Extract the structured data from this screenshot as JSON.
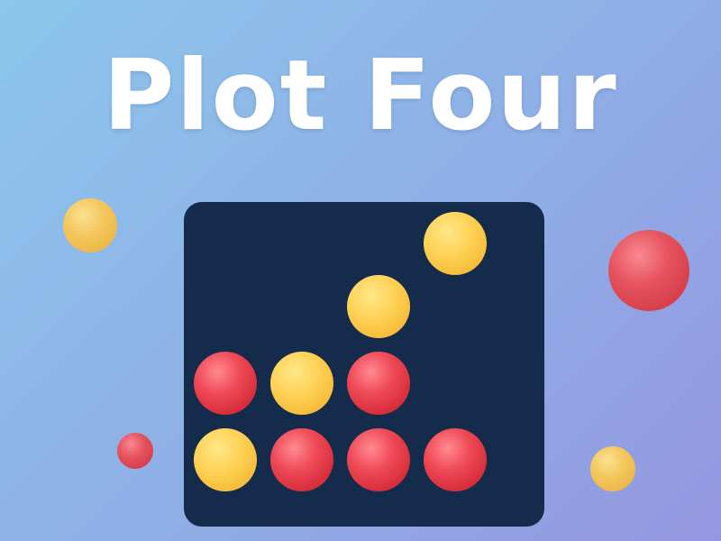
{
  "title": "Plot Four",
  "colors": {
    "red": "#e63c48",
    "yellow": "#fcc846",
    "board": "#152b4b"
  },
  "board": {
    "columns": 4,
    "rows": 4,
    "discs": [
      {
        "col": 1,
        "row": 1,
        "color": "yellow"
      },
      {
        "col": 2,
        "row": 1,
        "color": "red"
      },
      {
        "col": 3,
        "row": 1,
        "color": "red"
      },
      {
        "col": 4,
        "row": 1,
        "color": "red"
      },
      {
        "col": 1,
        "row": 2,
        "color": "red"
      },
      {
        "col": 2,
        "row": 2,
        "color": "yellow"
      },
      {
        "col": 3,
        "row": 2,
        "color": "red"
      },
      {
        "col": 3,
        "row": 3,
        "color": "yellow"
      },
      {
        "col": 4,
        "row": 4,
        "color": "yellow"
      }
    ]
  },
  "decorative_discs": [
    {
      "color": "yellow"
    },
    {
      "color": "red"
    },
    {
      "color": "red"
    },
    {
      "color": "yellow"
    }
  ]
}
